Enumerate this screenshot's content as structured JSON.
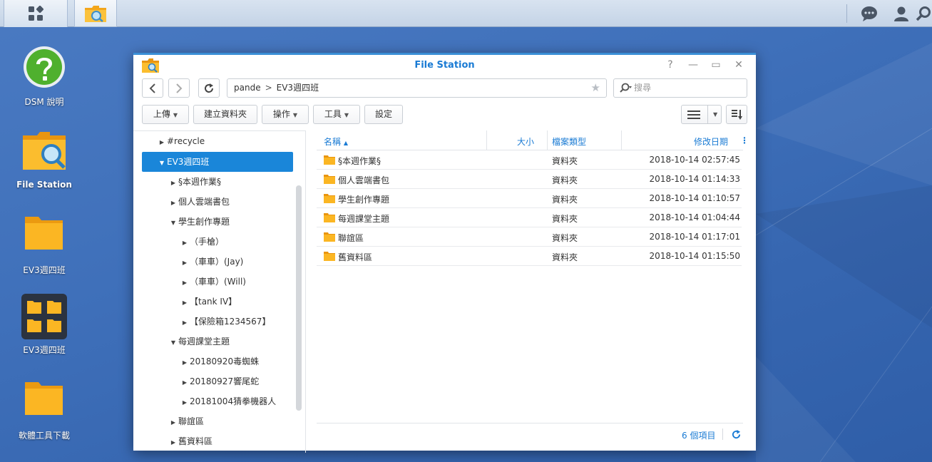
{
  "taskbar": {
    "main_menu_icon": "grid-icon",
    "app_icon": "file-station-icon",
    "right_icons": [
      "chat-icon",
      "user-icon",
      "search-icon"
    ]
  },
  "desktop": {
    "icons": [
      {
        "label": "DSM 說明",
        "icon": "help-icon"
      },
      {
        "label": "File Station",
        "icon": "file-station-icon"
      },
      {
        "label": "EV3週四班",
        "icon": "folder-icon"
      },
      {
        "label": "EV3週四班",
        "icon": "folder-group-icon"
      },
      {
        "label": "軟體工具下載",
        "icon": "folder-icon"
      }
    ]
  },
  "window": {
    "title": "File Station",
    "controls": {
      "help": "?",
      "minimize": "—",
      "maximize": "▭",
      "close": "✕"
    },
    "path": {
      "root": "pande",
      "sep": ">",
      "current": "EV3週四班"
    },
    "search_placeholder": "搜尋",
    "toolbar": {
      "upload": "上傳",
      "create_folder": "建立資料夾",
      "action": "操作",
      "tools": "工具",
      "settings": "設定"
    },
    "tree": [
      {
        "label": "#recycle",
        "level": 0,
        "expanded": false
      },
      {
        "label": "EV3週四班",
        "level": 0,
        "expanded": true,
        "selected": true
      },
      {
        "label": "§本週作業§",
        "level": 1,
        "expanded": false
      },
      {
        "label": "個人雲端書包",
        "level": 1,
        "expanded": false
      },
      {
        "label": "學生創作專題",
        "level": 1,
        "expanded": true
      },
      {
        "label": "（手槍）",
        "level": 2,
        "expanded": false
      },
      {
        "label": "（車車）(Jay)",
        "level": 2,
        "expanded": false
      },
      {
        "label": "（車車）(Will)",
        "level": 2,
        "expanded": false
      },
      {
        "label": "【tank IV】",
        "level": 2,
        "expanded": false
      },
      {
        "label": "【保險箱1234567】",
        "level": 2,
        "expanded": false
      },
      {
        "label": "每週課堂主題",
        "level": 1,
        "expanded": true
      },
      {
        "label": "20180920毒蜘蛛",
        "level": 2,
        "expanded": false
      },
      {
        "label": "20180927響尾蛇",
        "level": 2,
        "expanded": false
      },
      {
        "label": "20181004猜拳機器人",
        "level": 2,
        "expanded": false
      },
      {
        "label": "聯誼區",
        "level": 1,
        "expanded": false
      },
      {
        "label": "舊資料區",
        "level": 1,
        "expanded": false
      }
    ],
    "columns": {
      "name": "名稱",
      "size": "大小",
      "type": "檔案類型",
      "modified": "修改日期"
    },
    "files": [
      {
        "name": "§本週作業§",
        "size": "",
        "type": "資料夾",
        "modified": "2018-10-14 02:57:45"
      },
      {
        "name": "個人雲端書包",
        "size": "",
        "type": "資料夾",
        "modified": "2018-10-14 01:14:33"
      },
      {
        "name": "學生創作專題",
        "size": "",
        "type": "資料夾",
        "modified": "2018-10-14 01:10:57"
      },
      {
        "name": "每週課堂主題",
        "size": "",
        "type": "資料夾",
        "modified": "2018-10-14 01:04:44"
      },
      {
        "name": "聯誼區",
        "size": "",
        "type": "資料夾",
        "modified": "2018-10-14 01:17:01"
      },
      {
        "name": "舊資料區",
        "size": "",
        "type": "資料夾",
        "modified": "2018-10-14 01:15:50"
      }
    ],
    "footer": {
      "count": "6 個項目"
    }
  },
  "colors": {
    "accent": "#1a86d9",
    "folder": "#f8b21a",
    "desktop": "#3d6cb5"
  }
}
